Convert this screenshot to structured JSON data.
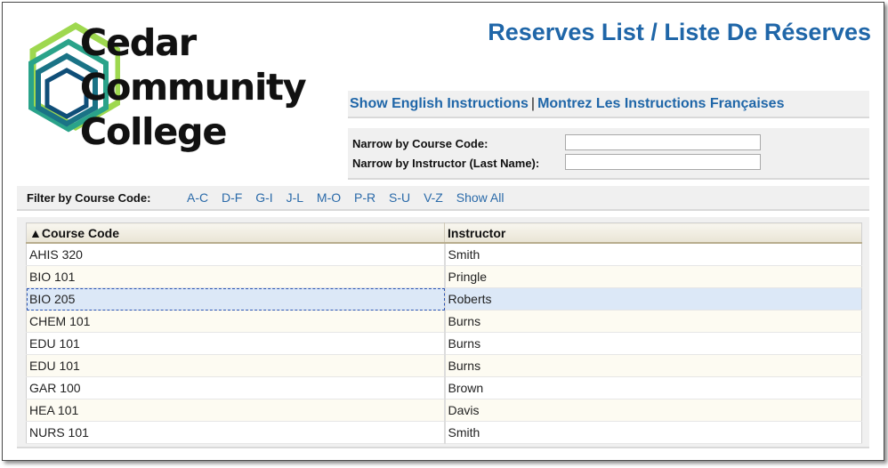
{
  "logo": {
    "lines": [
      "Cedar",
      "Community",
      "College"
    ],
    "colors": [
      "#8fd14f",
      "#2aa38a",
      "#1a7386",
      "#0f4e78"
    ]
  },
  "title": "Reserves List / Liste De Réserves",
  "instructions": {
    "english": "Show English Instructions",
    "separator": "|",
    "french": "Montrez Les Instructions Françaises"
  },
  "narrow": {
    "course_label": "Narrow by Course Code:",
    "course_value": "",
    "instructor_label": "Narrow by Instructor (Last Name):",
    "instructor_value": ""
  },
  "filter": {
    "label": "Filter by Course Code:",
    "links": [
      "A-C",
      "D-F",
      "G-I",
      "J-L",
      "M-O",
      "P-R",
      "S-U",
      "V-Z",
      "Show All"
    ]
  },
  "table": {
    "headers": [
      "▲Course Code",
      "Instructor"
    ],
    "rows": [
      {
        "course": "AHIS 320",
        "instructor": "Smith"
      },
      {
        "course": "BIO 101",
        "instructor": "Pringle"
      },
      {
        "course": "BIO 205",
        "instructor": "Roberts"
      },
      {
        "course": "CHEM 101",
        "instructor": "Burns"
      },
      {
        "course": "EDU 101",
        "instructor": "Burns"
      },
      {
        "course": "EDU 101",
        "instructor": "Burns"
      },
      {
        "course": "GAR 100",
        "instructor": "Brown"
      },
      {
        "course": "HEA 101",
        "instructor": "Davis"
      },
      {
        "course": "NURS 101",
        "instructor": "Smith"
      }
    ],
    "selected_index": 2
  }
}
